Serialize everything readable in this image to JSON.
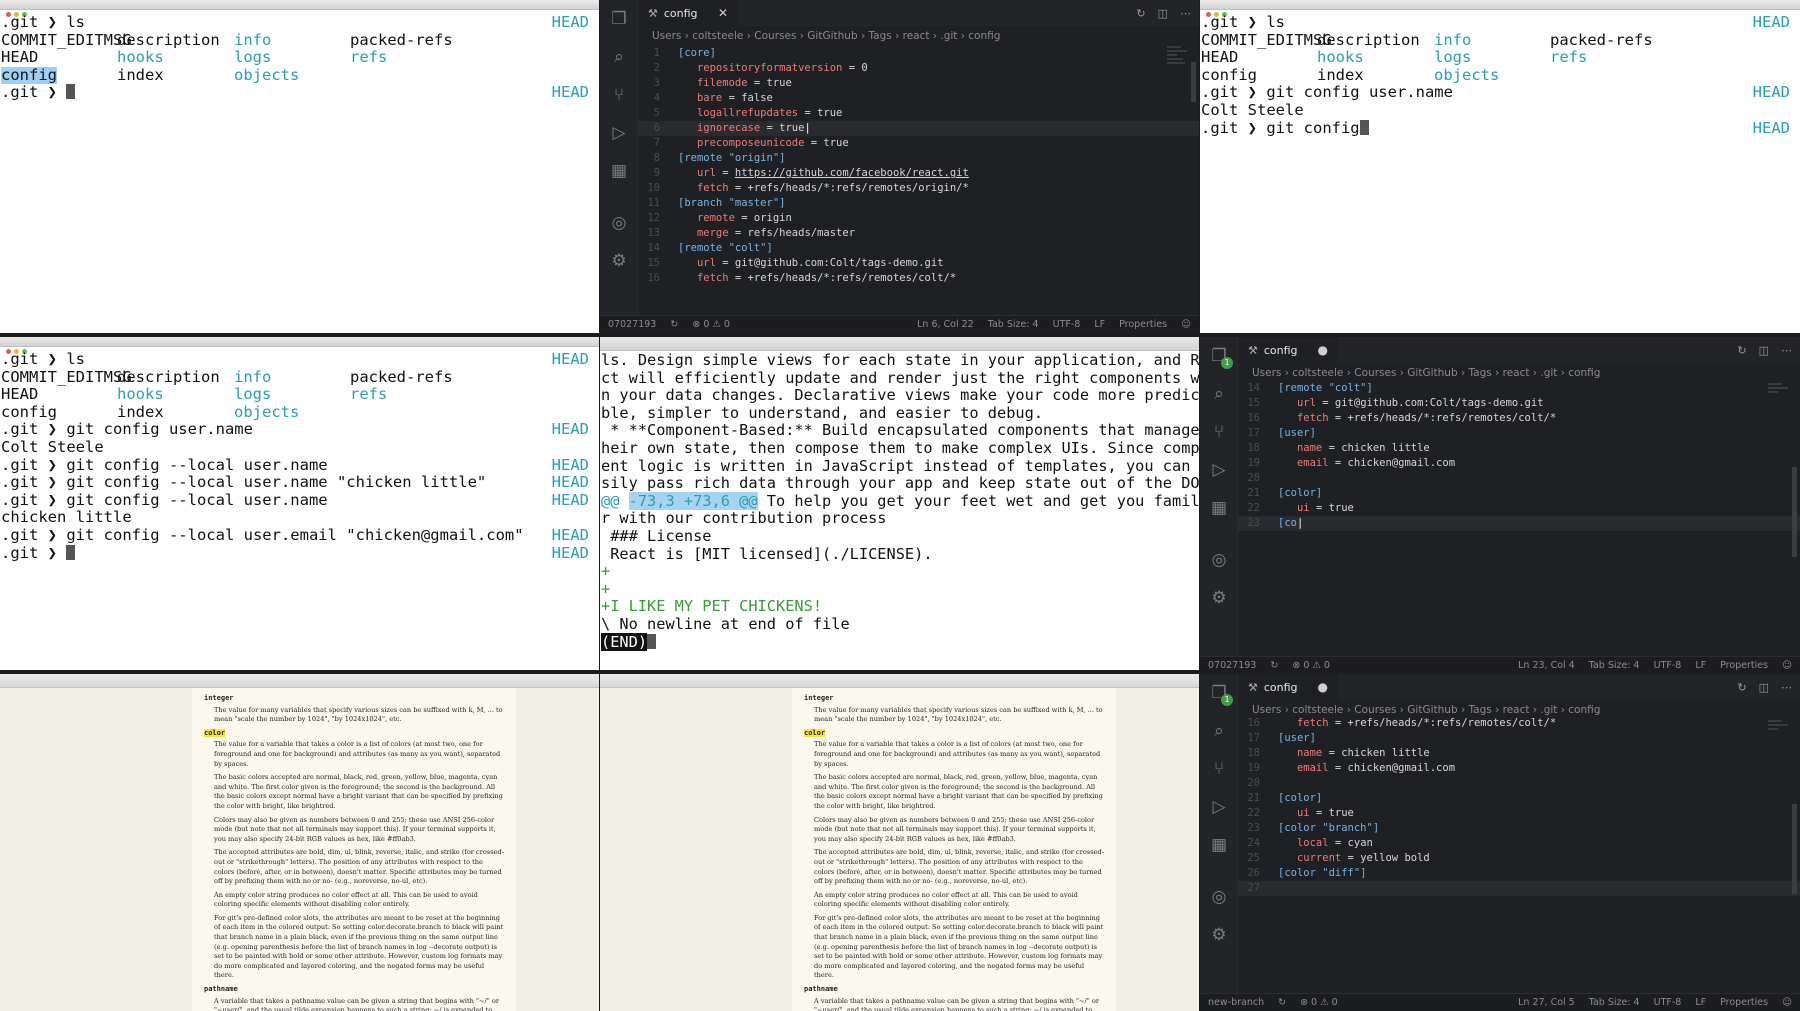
{
  "term_top_left": {
    "lines": [
      {
        "cols": [
          ".git ❯ ls"
        ],
        "right": "HEAD"
      },
      {
        "cols": [
          "COMMIT_EDITMSG",
          "description",
          "info",
          "packed-refs"
        ],
        "colors": [
          "",
          "",
          "cyan",
          ""
        ]
      },
      {
        "cols": [
          "HEAD",
          "hooks",
          "logs",
          "refs"
        ],
        "colors": [
          "",
          "cyan",
          "cyan",
          "cyan"
        ]
      },
      {
        "cols": [
          "config",
          "index",
          "objects",
          ""
        ],
        "colors": [
          "sel",
          "",
          "cyan",
          ""
        ]
      },
      {
        "cols": [
          ".git ❯ "
        ],
        "right": "HEAD",
        "cursor": true
      }
    ]
  },
  "vscode_top": {
    "tab_label": "config",
    "breadcrumbs": [
      "Users",
      "coltsteele",
      "Courses",
      "GitGithub",
      "Tags",
      "react",
      ".git",
      "config"
    ],
    "lines": [
      {
        "n": "1",
        "t": "[core]",
        "k": "sec"
      },
      {
        "n": "2",
        "t": "repositoryformatversion = 0",
        "k": "kv",
        "key": "repositoryformatversion",
        "val": "0"
      },
      {
        "n": "3",
        "t": "",
        "k": "kv",
        "key": "filemode",
        "val": "true"
      },
      {
        "n": "4",
        "t": "",
        "k": "kv",
        "key": "bare",
        "val": "false"
      },
      {
        "n": "5",
        "t": "",
        "k": "kv",
        "key": "logallrefupdates",
        "val": "true"
      },
      {
        "n": "6",
        "t": "",
        "k": "kv",
        "key": "ignorecase",
        "val": "true"
      },
      {
        "n": "7",
        "t": "",
        "k": "kv",
        "key": "precomposeunicode",
        "val": "true"
      },
      {
        "n": "8",
        "t": "[remote \"origin\"]",
        "k": "sec"
      },
      {
        "n": "9",
        "t": "",
        "k": "kv",
        "key": "url",
        "val": "https://github.com/facebook/react.git"
      },
      {
        "n": "10",
        "t": "",
        "k": "kv",
        "key": "fetch",
        "val": "+refs/heads/*:refs/remotes/origin/*"
      },
      {
        "n": "11",
        "t": "[branch \"master\"]",
        "k": "sec"
      },
      {
        "n": "12",
        "t": "",
        "k": "kv",
        "key": "remote",
        "val": "origin"
      },
      {
        "n": "13",
        "t": "",
        "k": "kv",
        "key": "merge",
        "val": "refs/heads/master"
      },
      {
        "n": "14",
        "t": "[remote \"colt\"]",
        "k": "sec"
      },
      {
        "n": "15",
        "t": "",
        "k": "kv",
        "key": "url",
        "val": "git@github.com:Colt/tags-demo.git"
      },
      {
        "n": "16",
        "t": "",
        "k": "kv",
        "key": "fetch",
        "val": "+refs/heads/*:refs/remotes/colt/*"
      }
    ],
    "status": {
      "branch": "07027193",
      "problems": "0 ⚠ 0",
      "pos": "Ln 6, Col 22",
      "tab": "Tab Size: 4",
      "enc": "UTF-8",
      "eol": "LF",
      "lang": "Properties"
    }
  },
  "term_top_right": {
    "lines": [
      {
        "cols": [
          ".git ❯ ls"
        ],
        "right": "HEAD"
      },
      {
        "cols": [
          "COMMIT_EDITMSG",
          "description",
          "info",
          "packed-refs"
        ],
        "colors": [
          "",
          "",
          "cyan",
          ""
        ]
      },
      {
        "cols": [
          "HEAD",
          "hooks",
          "logs",
          "refs"
        ],
        "colors": [
          "",
          "cyan",
          "cyan",
          "cyan"
        ]
      },
      {
        "cols": [
          "config",
          "index",
          "objects",
          ""
        ],
        "colors": [
          "",
          "",
          "cyan",
          ""
        ]
      },
      {
        "cols": [
          ".git ❯ git config user.name"
        ],
        "right": "HEAD"
      },
      {
        "cols": [
          "Colt Steele"
        ]
      },
      {
        "cols": [
          ".git ❯ git config"
        ],
        "right": "HEAD",
        "cursor": true
      }
    ]
  },
  "term_mid_left": {
    "lines": [
      {
        "cols": [
          ".git ❯ ls"
        ],
        "right": "HEAD"
      },
      {
        "cols": [
          "COMMIT_EDITMSG",
          "description",
          "info",
          "packed-refs"
        ],
        "colors": [
          "",
          "",
          "cyan",
          ""
        ]
      },
      {
        "cols": [
          "HEAD",
          "hooks",
          "logs",
          "refs"
        ],
        "colors": [
          "",
          "cyan",
          "cyan",
          "cyan"
        ]
      },
      {
        "cols": [
          "config",
          "index",
          "objects",
          ""
        ],
        "colors": [
          "",
          "",
          "cyan",
          ""
        ]
      },
      {
        "cols": [
          ".git ❯ git config user.name"
        ],
        "right": "HEAD"
      },
      {
        "cols": [
          "Colt Steele"
        ]
      },
      {
        "cols": [
          ".git ❯ git config --local user.name"
        ],
        "right": "HEAD"
      },
      {
        "cols": [
          ".git ❯ git config --local user.name \"chicken little\""
        ],
        "right": "HEAD"
      },
      {
        "cols": [
          ".git ❯ git config --local user.name"
        ],
        "right": "HEAD"
      },
      {
        "cols": [
          "chicken little"
        ]
      },
      {
        "cols": [
          ".git ❯ git config --local user.email \"chicken@gmail.com\""
        ],
        "right": "HEAD"
      },
      {
        "cols": [
          ".git ❯ "
        ],
        "right": "HEAD",
        "cursor": true
      }
    ]
  },
  "less_mid": {
    "lines": [
      "ls. Design simple views for each state in your application, and Rea",
      "ct will efficiently update and render just the right components whe",
      "n your data changes. Declarative views make your code more predicta",
      "ble, simpler to understand, and easier to debug.",
      " * **Component-Based:** Build encapsulated components that manage t",
      "heir own state, then compose them to make complex UIs. Since compon",
      "ent logic is written in JavaScript instead of templates, you can ea",
      "sily pass rich data through your app and keep state out of the DOM."
    ],
    "hunk_prefix": "@@ ",
    "hunk_range": "-73,3 +73,6 @@",
    "hunk_rest": " To help you get your feet wet and get you familia",
    "after": [
      "r with our contribution process",
      " ### License",
      "",
      " React is [MIT licensed](./LICENSE)."
    ],
    "added": [
      "+",
      "+",
      "+I LIKE MY PET CHICKENS!"
    ],
    "no_newline": "\\ No newline at end of file",
    "end": "(END)"
  },
  "vscode_mid": {
    "tab_label": "config",
    "breadcrumbs": [
      "Users",
      "coltsteele",
      "Courses",
      "GitGithub",
      "Tags",
      "react",
      ".git",
      "config"
    ],
    "badge": "1",
    "lines": [
      {
        "n": "14",
        "k": "sec",
        "t": "[remote \"colt\"]"
      },
      {
        "n": "15",
        "k": "kv",
        "key": "url",
        "val": "git@github.com:Colt/tags-demo.git"
      },
      {
        "n": "16",
        "k": "kv",
        "key": "fetch",
        "val": "+refs/heads/*:refs/remotes/colt/*"
      },
      {
        "n": "17",
        "k": "sec",
        "t": "[user]"
      },
      {
        "n": "18",
        "k": "kv",
        "key": "name",
        "val": "chicken little"
      },
      {
        "n": "19",
        "k": "kv",
        "key": "email",
        "val": "chicken@gmail.com"
      },
      {
        "n": "20",
        "k": "blank",
        "t": ""
      },
      {
        "n": "21",
        "k": "sec",
        "t": "[color]"
      },
      {
        "n": "22",
        "k": "kv",
        "key": "ui",
        "val": "true"
      },
      {
        "n": "23",
        "k": "sec",
        "t": "[co"
      }
    ],
    "status": {
      "branch": "07027193",
      "problems": "0 ⚠ 0",
      "pos": "Ln 23, Col 4",
      "tab": "Tab Size: 4",
      "enc": "UTF-8",
      "eol": "LF",
      "lang": "Properties"
    }
  },
  "vscode_bot": {
    "tab_label": "config",
    "breadcrumbs": [
      "Users",
      "coltsteele",
      "Courses",
      "GitGithub",
      "Tags",
      "react",
      ".git",
      "config"
    ],
    "badge": "1",
    "lines": [
      {
        "n": "16",
        "k": "kv",
        "key": "fetch",
        "val": "+refs/heads/*:refs/remotes/colt/*"
      },
      {
        "n": "17",
        "k": "sec",
        "t": "[user]"
      },
      {
        "n": "18",
        "k": "kv",
        "key": "name",
        "val": "chicken little"
      },
      {
        "n": "19",
        "k": "kv",
        "key": "email",
        "val": "chicken@gmail.com"
      },
      {
        "n": "20",
        "k": "blank",
        "t": ""
      },
      {
        "n": "21",
        "k": "sec",
        "t": "[color]"
      },
      {
        "n": "22",
        "k": "kv",
        "key": "ui",
        "val": "true"
      },
      {
        "n": "23",
        "k": "sec",
        "t": "[color \"branch\"]"
      },
      {
        "n": "24",
        "k": "kv",
        "key": "local",
        "val": "cyan"
      },
      {
        "n": "25",
        "k": "kv",
        "key": "current",
        "val": "yellow bold"
      },
      {
        "n": "26",
        "k": "sec",
        "t": "[color \"diff\"]"
      },
      {
        "n": "27",
        "k": "blank",
        "t": ""
      }
    ],
    "status": {
      "branch": "new-branch",
      "problems": "0 ⚠ 0",
      "pos": "Ln 27, Col 5",
      "tab": "Tab Size: 4",
      "enc": "UTF-8",
      "eol": "LF",
      "lang": "Properties"
    }
  },
  "docs": {
    "h_integer": "integer",
    "p_integer": "The value for many variables that specify various sizes can be suffixed with k, M, ... to mean \"scale the number by 1024\", \"by 1024x1024\", etc.",
    "h_color": "color",
    "p_color1": "The value for a variable that takes a color is a list of colors (at most two, one for foreground and one for background) and attributes (as many as you want), separated by spaces.",
    "p_color2": "The basic colors accepted are normal, black, red, green, yellow, blue, magenta, cyan and white. The first color given is the foreground; the second is the background. All the basic colors except normal have a bright variant that can be specified by prefixing the color with bright, like brightred.",
    "p_color3": "Colors may also be given as numbers between 0 and 255; these use ANSI 256-color mode (but note that not all terminals may support this). If your terminal supports it, you may also specify 24-bit RGB values as hex, like #ff0ab3.",
    "p_color4": "The accepted attributes are bold, dim, ul, blink, reverse, italic, and strike (for crossed-out or \"strikethrough\" letters). The position of any attributes with respect to the colors (before, after, or in between), doesn't matter. Specific attributes may be turned off by prefixing them with no or no- (e.g., noreverse, no-ul, etc).",
    "p_color5": "An empty color string produces no color effect at all. This can be used to avoid coloring specific elements without disabling color entirely.",
    "p_color6": "For git's pre-defined color slots, the attributes are meant to be reset at the beginning of each item in the colored output. So setting color.decorate.branch to black will paint that branch name in a plain black, even if the previous thing on the same output line (e.g. opening parenthesis before the list of branch names in log --decorate output) is set to be painted with bold or some other attribute. However, custom log formats may do more complicated and layered coloring, and the negated forms may be useful there.",
    "h_pathname": "pathname",
    "p_pathname": "A variable that takes a pathname value can be given a string that begins with \"~/\" or \"~user/\", and the usual tilde expansion happens to such a string: ~/ is expanded to the value of $HOME, and"
  }
}
